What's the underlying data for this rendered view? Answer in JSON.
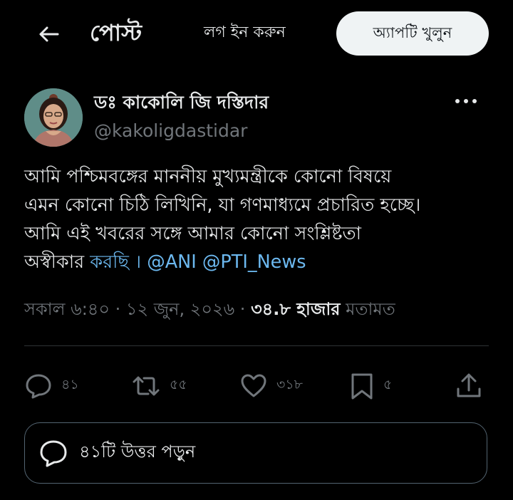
{
  "header": {
    "back_icon": "arrow-left-icon",
    "title": "পোস্ট",
    "login_label": "লগ ইন করুন",
    "open_app_label": "অ্যাপটি খুলুন"
  },
  "post": {
    "author": {
      "display_name": "ডঃ কাকোলি জি দস্তিদার",
      "handle": "@kakoligdastidar",
      "avatar_icon": "profile-photo"
    },
    "more_icon": "more-options-icon",
    "text": {
      "line1": "আমি পশ্চিমবঙ্গের মাননীয় মুখ্যমন্ত্রীকে কোনো বিষয়ে",
      "line2": "এমন কোনো চিঠি লিখিনি, যা গণমাধ্যমে প্রচারিত হচ্ছে।",
      "line3": "আমি এই খবরের সঙ্গে আমার কোনো সংশ্লিষ্টতা",
      "line4_start": "অস্বীকার ",
      "line4_link": "করছি । @ANI @PTI_News"
    },
    "meta": {
      "time": "সকাল ৬:৪০",
      "separator": " · ",
      "date": "১২ জুন, ২০২৬",
      "views_count": "৩৪.৮ হাজার",
      "views_label": " মতামত"
    },
    "actions": {
      "reply_count": "৪১",
      "repost_count": "৫৫",
      "like_count": "৩১৮",
      "bookmark_count": "৫"
    },
    "read_replies_label": "৪১টি উত্তর পড়ুন"
  },
  "colors": {
    "background": "#000000",
    "text_primary": "#e7e9ea",
    "text_secondary": "#71767b",
    "link": "#6cb8ef",
    "button_light": "#eff3f4",
    "divider": "#2f3336"
  }
}
